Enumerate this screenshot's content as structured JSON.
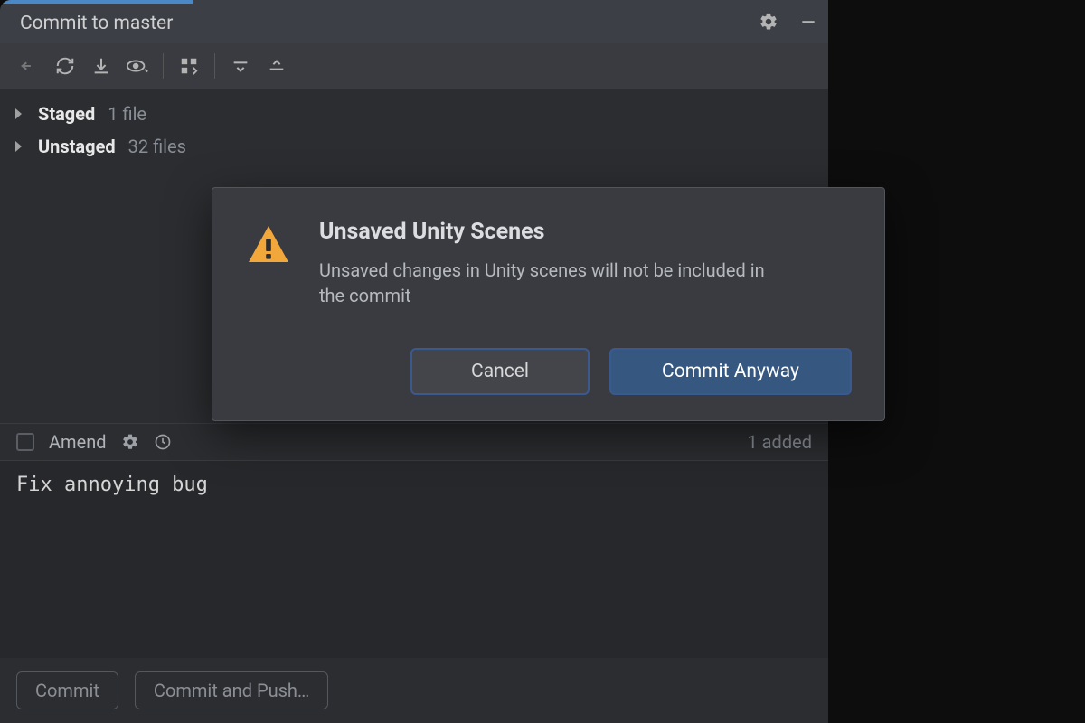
{
  "header": {
    "tab_title": "Commit to master"
  },
  "tree": {
    "staged_label": "Staged",
    "staged_count": "1 file",
    "unstaged_label": "Unstaged",
    "unstaged_count": "32 files"
  },
  "amend": {
    "label": "Amend",
    "added": "1 added"
  },
  "message": {
    "text": "Fix annoying bug"
  },
  "footer": {
    "commit": "Commit",
    "commit_push": "Commit and Push…"
  },
  "dialog": {
    "title": "Unsaved Unity Scenes",
    "message": "Unsaved changes in Unity scenes will not be included in the commit",
    "cancel": "Cancel",
    "confirm": "Commit Anyway"
  }
}
